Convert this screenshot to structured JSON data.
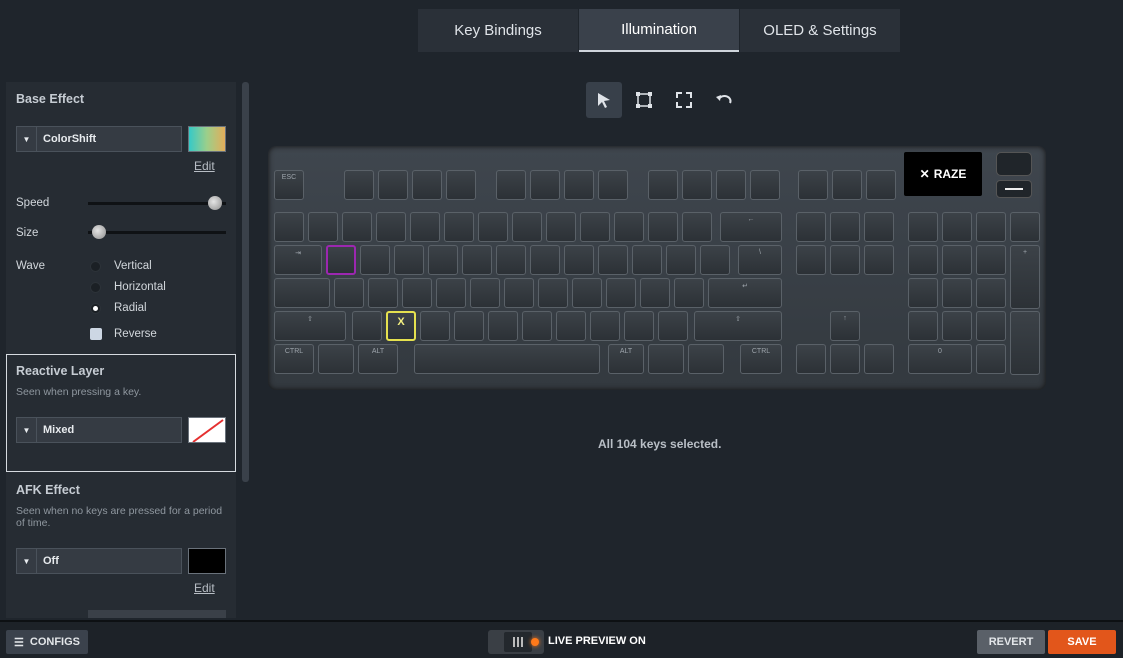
{
  "tabs": [
    {
      "label": "Key Bindings"
    },
    {
      "label": "Illumination",
      "active": true
    },
    {
      "label": "OLED & Settings"
    }
  ],
  "base_effect": {
    "title": "Base Effect",
    "dropdown": "ColorShift",
    "edit": "Edit",
    "speed_label": "Speed",
    "speed_value": 0.93,
    "size_label": "Size",
    "size_value": 0.06,
    "wave_label": "Wave",
    "wave_options": [
      "Vertical",
      "Horizontal",
      "Radial"
    ],
    "wave_selected": "Radial",
    "reverse_label": "Reverse"
  },
  "reactive": {
    "title": "Reactive Layer",
    "subtitle": "Seen when pressing a key.",
    "dropdown": "Mixed"
  },
  "afk": {
    "title": "AFK Effect",
    "subtitle": "Seen when no keys are pressed for a period of time.",
    "dropdown": "Off",
    "edit": "Edit"
  },
  "toolbar": {
    "icons": [
      "cursor-icon",
      "select-box-icon",
      "expand-icon",
      "undo-icon"
    ]
  },
  "keyboard": {
    "oled_text": "RAZE",
    "selected_purple": "Q",
    "selected_yellow": "X"
  },
  "status": "All 104 keys selected.",
  "bottom": {
    "configs": "CONFIGS",
    "live_preview": "LIVE PREVIEW ON",
    "revert": "REVERT",
    "save": "SAVE"
  },
  "colors": {
    "accent": "#e2561b",
    "selected_key_1": "#9c27b0",
    "selected_key_2": "#e5e14f"
  }
}
